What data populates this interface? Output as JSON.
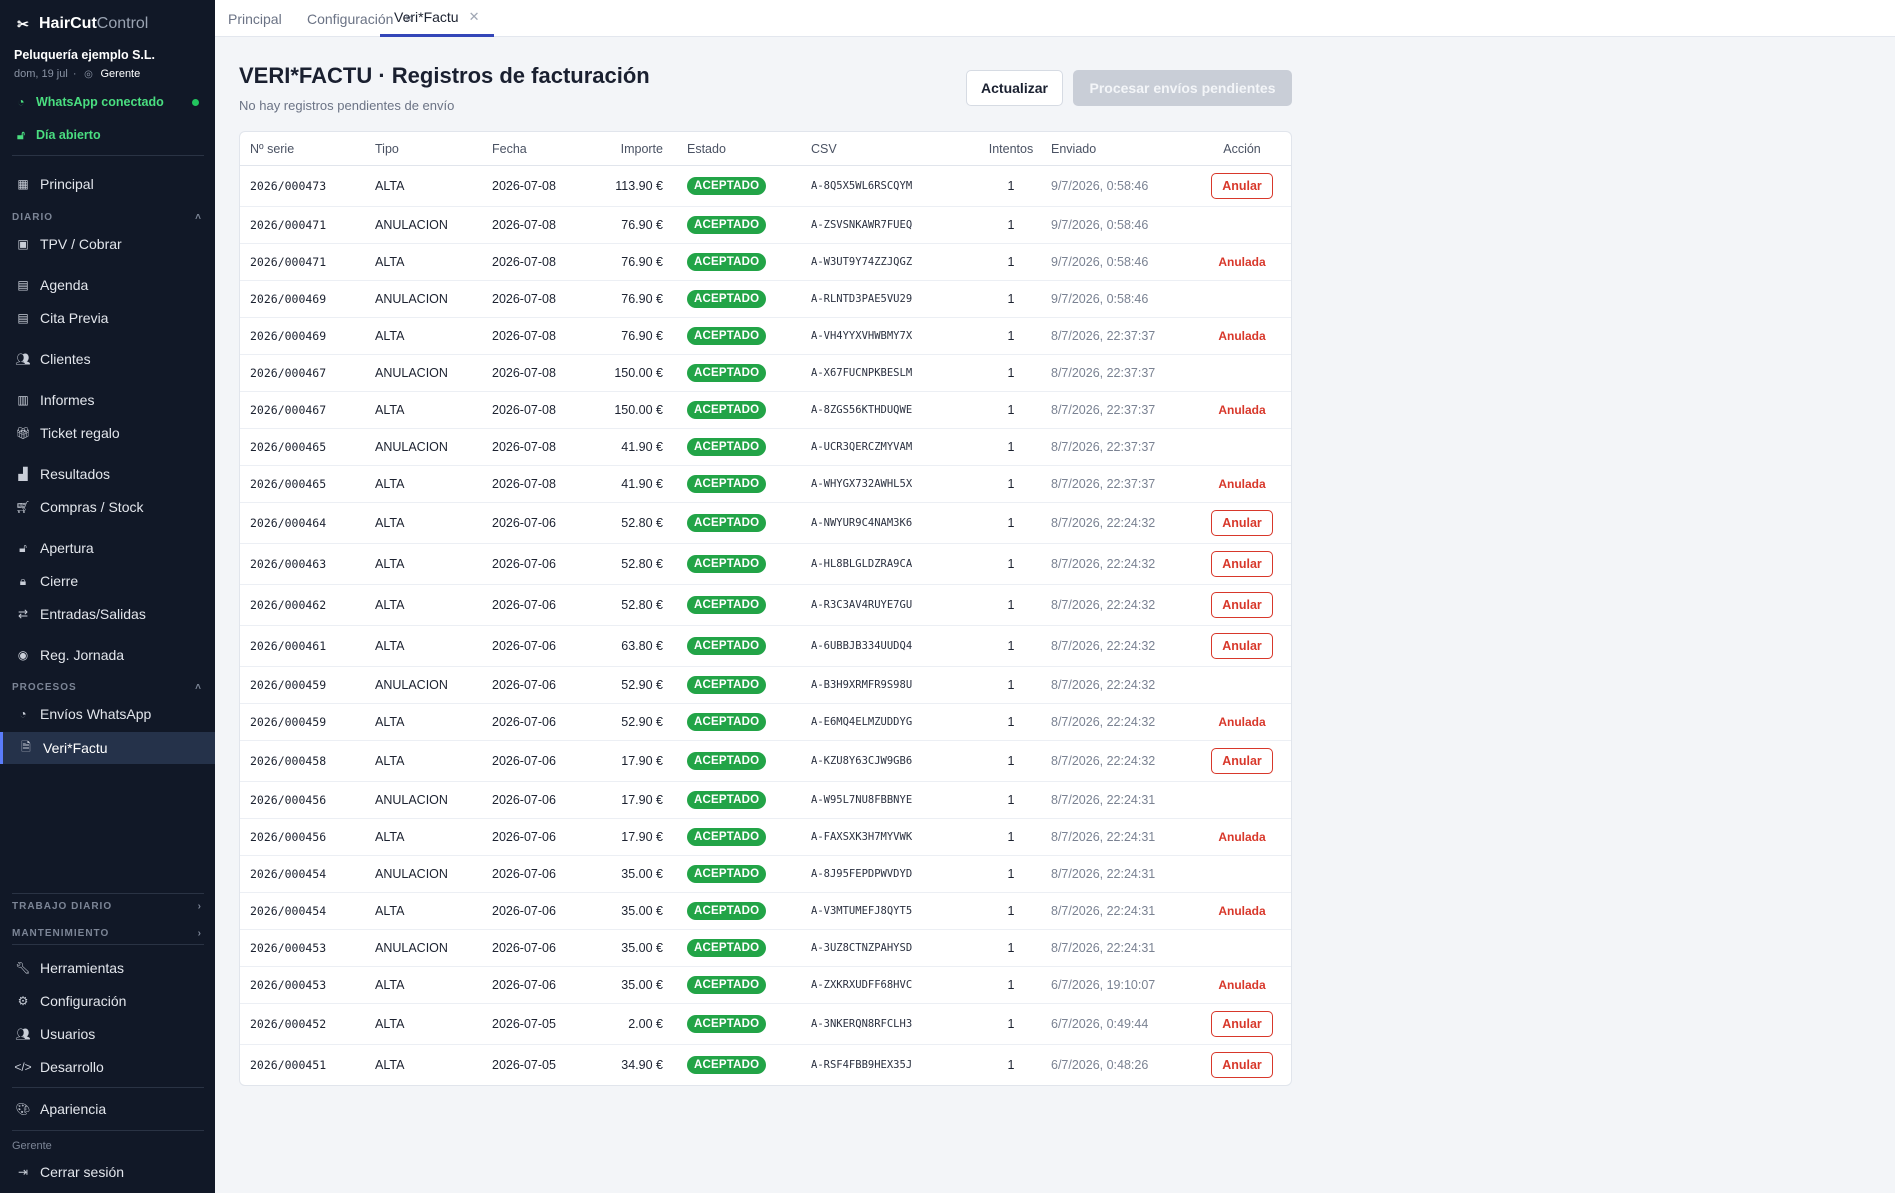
{
  "app": {
    "brand_a": "HairCut",
    "brand_b": "Control",
    "company": "Peluquería ejemplo S.L.",
    "date": "dom, 19 jul",
    "role": "Gerente"
  },
  "status": {
    "whatsapp": "WhatsApp conectado",
    "day": "Día abierto"
  },
  "sidebar": {
    "principal": "Principal",
    "sec_diario": "DIARIO",
    "items_diario": [
      "TPV / Cobrar",
      "Agenda",
      "Cita Previa",
      "Clientes",
      "Informes",
      "Ticket regalo",
      "Resultados",
      "Compras / Stock",
      "Apertura",
      "Cierre",
      "Entradas/Salidas",
      "Reg. Jornada"
    ],
    "sec_procesos": "PROCESOS",
    "items_procesos": [
      "Envíos WhatsApp",
      "Veri*Factu"
    ],
    "sec_trabajo": "TRABAJO DIARIO",
    "sec_mant": "MANTENIMIENTO",
    "items_mant": [
      "Herramientas",
      "Configuración",
      "Usuarios",
      "Desarrollo"
    ],
    "apariencia": "Apariencia",
    "footer_role": "Gerente",
    "logout": "Cerrar sesión"
  },
  "tabs": [
    {
      "label": "Principal"
    },
    {
      "label": "Configuración"
    },
    {
      "label": "Veri*Factu"
    }
  ],
  "page": {
    "title": "VERI*FACTU · Registros de facturación",
    "subtitle": "No hay registros pendientes de envío",
    "btn_refresh": "Actualizar",
    "btn_process": "Procesar envíos pendientes"
  },
  "table": {
    "headers": [
      "Nº serie",
      "Tipo",
      "Fecha",
      "Importe",
      "Estado",
      "CSV",
      "Intentos",
      "Enviado",
      "Acción"
    ],
    "rows": [
      {
        "serie": "2026/000473",
        "tipo": "ALTA",
        "fecha": "2026-07-08",
        "importe": "113.90 €",
        "estado": "ACEPTADO",
        "csv": "A-8Q5X5WL6RSCQYM",
        "intentos": "1",
        "enviado": "9/7/2026, 0:58:46",
        "accion": "Anular"
      },
      {
        "serie": "2026/000471",
        "tipo": "ANULACION",
        "fecha": "2026-07-08",
        "importe": "76.90 €",
        "estado": "ACEPTADO",
        "csv": "A-ZSVSNKAWR7FUEQ",
        "intentos": "1",
        "enviado": "9/7/2026, 0:58:46",
        "accion": ""
      },
      {
        "serie": "2026/000471",
        "tipo": "ALTA",
        "fecha": "2026-07-08",
        "importe": "76.90 €",
        "estado": "ACEPTADO",
        "csv": "A-W3UT9Y74ZZJQGZ",
        "intentos": "1",
        "enviado": "9/7/2026, 0:58:46",
        "accion": "Anulada"
      },
      {
        "serie": "2026/000469",
        "tipo": "ANULACION",
        "fecha": "2026-07-08",
        "importe": "76.90 €",
        "estado": "ACEPTADO",
        "csv": "A-RLNTD3PAE5VU29",
        "intentos": "1",
        "enviado": "9/7/2026, 0:58:46",
        "accion": ""
      },
      {
        "serie": "2026/000469",
        "tipo": "ALTA",
        "fecha": "2026-07-08",
        "importe": "76.90 €",
        "estado": "ACEPTADO",
        "csv": "A-VH4YYXVHWBMY7X",
        "intentos": "1",
        "enviado": "8/7/2026, 22:37:37",
        "accion": "Anulada"
      },
      {
        "serie": "2026/000467",
        "tipo": "ANULACION",
        "fecha": "2026-07-08",
        "importe": "150.00 €",
        "estado": "ACEPTADO",
        "csv": "A-X67FUCNPKBESLM",
        "intentos": "1",
        "enviado": "8/7/2026, 22:37:37",
        "accion": ""
      },
      {
        "serie": "2026/000467",
        "tipo": "ALTA",
        "fecha": "2026-07-08",
        "importe": "150.00 €",
        "estado": "ACEPTADO",
        "csv": "A-8ZGS56KTHDUQWE",
        "intentos": "1",
        "enviado": "8/7/2026, 22:37:37",
        "accion": "Anulada"
      },
      {
        "serie": "2026/000465",
        "tipo": "ANULACION",
        "fecha": "2026-07-08",
        "importe": "41.90 €",
        "estado": "ACEPTADO",
        "csv": "A-UCR3QERCZMYVAM",
        "intentos": "1",
        "enviado": "8/7/2026, 22:37:37",
        "accion": ""
      },
      {
        "serie": "2026/000465",
        "tipo": "ALTA",
        "fecha": "2026-07-08",
        "importe": "41.90 €",
        "estado": "ACEPTADO",
        "csv": "A-WHYGX732AWHL5X",
        "intentos": "1",
        "enviado": "8/7/2026, 22:37:37",
        "accion": "Anulada"
      },
      {
        "serie": "2026/000464",
        "tipo": "ALTA",
        "fecha": "2026-07-06",
        "importe": "52.80 €",
        "estado": "ACEPTADO",
        "csv": "A-NWYUR9C4NAM3K6",
        "intentos": "1",
        "enviado": "8/7/2026, 22:24:32",
        "accion": "Anular"
      },
      {
        "serie": "2026/000463",
        "tipo": "ALTA",
        "fecha": "2026-07-06",
        "importe": "52.80 €",
        "estado": "ACEPTADO",
        "csv": "A-HL8BLGLDZRA9CA",
        "intentos": "1",
        "enviado": "8/7/2026, 22:24:32",
        "accion": "Anular"
      },
      {
        "serie": "2026/000462",
        "tipo": "ALTA",
        "fecha": "2026-07-06",
        "importe": "52.80 €",
        "estado": "ACEPTADO",
        "csv": "A-R3C3AV4RUYE7GU",
        "intentos": "1",
        "enviado": "8/7/2026, 22:24:32",
        "accion": "Anular"
      },
      {
        "serie": "2026/000461",
        "tipo": "ALTA",
        "fecha": "2026-07-06",
        "importe": "63.80 €",
        "estado": "ACEPTADO",
        "csv": "A-6UBBJB334UUDQ4",
        "intentos": "1",
        "enviado": "8/7/2026, 22:24:32",
        "accion": "Anular"
      },
      {
        "serie": "2026/000459",
        "tipo": "ANULACION",
        "fecha": "2026-07-06",
        "importe": "52.90 €",
        "estado": "ACEPTADO",
        "csv": "A-B3H9XRMFR9S98U",
        "intentos": "1",
        "enviado": "8/7/2026, 22:24:32",
        "accion": ""
      },
      {
        "serie": "2026/000459",
        "tipo": "ALTA",
        "fecha": "2026-07-06",
        "importe": "52.90 €",
        "estado": "ACEPTADO",
        "csv": "A-E6MQ4ELMZUDDYG",
        "intentos": "1",
        "enviado": "8/7/2026, 22:24:32",
        "accion": "Anulada"
      },
      {
        "serie": "2026/000458",
        "tipo": "ALTA",
        "fecha": "2026-07-06",
        "importe": "17.90 €",
        "estado": "ACEPTADO",
        "csv": "A-KZU8Y63CJW9GB6",
        "intentos": "1",
        "enviado": "8/7/2026, 22:24:32",
        "accion": "Anular"
      },
      {
        "serie": "2026/000456",
        "tipo": "ANULACION",
        "fecha": "2026-07-06",
        "importe": "17.90 €",
        "estado": "ACEPTADO",
        "csv": "A-W95L7NU8FBBNYE",
        "intentos": "1",
        "enviado": "8/7/2026, 22:24:31",
        "accion": ""
      },
      {
        "serie": "2026/000456",
        "tipo": "ALTA",
        "fecha": "2026-07-06",
        "importe": "17.90 €",
        "estado": "ACEPTADO",
        "csv": "A-FAXSXK3H7MYVWK",
        "intentos": "1",
        "enviado": "8/7/2026, 22:24:31",
        "accion": "Anulada"
      },
      {
        "serie": "2026/000454",
        "tipo": "ANULACION",
        "fecha": "2026-07-06",
        "importe": "35.00 €",
        "estado": "ACEPTADO",
        "csv": "A-8J95FEPDPWVDYD",
        "intentos": "1",
        "enviado": "8/7/2026, 22:24:31",
        "accion": ""
      },
      {
        "serie": "2026/000454",
        "tipo": "ALTA",
        "fecha": "2026-07-06",
        "importe": "35.00 €",
        "estado": "ACEPTADO",
        "csv": "A-V3MTUMEFJ8QYT5",
        "intentos": "1",
        "enviado": "8/7/2026, 22:24:31",
        "accion": "Anulada"
      },
      {
        "serie": "2026/000453",
        "tipo": "ANULACION",
        "fecha": "2026-07-06",
        "importe": "35.00 €",
        "estado": "ACEPTADO",
        "csv": "A-3UZ8CTNZPAHYSD",
        "intentos": "1",
        "enviado": "8/7/2026, 22:24:31",
        "accion": ""
      },
      {
        "serie": "2026/000453",
        "tipo": "ALTA",
        "fecha": "2026-07-06",
        "importe": "35.00 €",
        "estado": "ACEPTADO",
        "csv": "A-ZXKRXUDFF68HVC",
        "intentos": "1",
        "enviado": "6/7/2026, 19:10:07",
        "accion": "Anulada"
      },
      {
        "serie": "2026/000452",
        "tipo": "ALTA",
        "fecha": "2026-07-05",
        "importe": "2.00 €",
        "estado": "ACEPTADO",
        "csv": "A-3NKERQN8RFCLH3",
        "intentos": "1",
        "enviado": "6/7/2026, 0:49:44",
        "accion": "Anular"
      },
      {
        "serie": "2026/000451",
        "tipo": "ALTA",
        "fecha": "2026-07-05",
        "importe": "34.90 €",
        "estado": "ACEPTADO",
        "csv": "A-RSF4FBB9HEX35J",
        "intentos": "1",
        "enviado": "6/7/2026, 0:48:26",
        "accion": "Anular"
      }
    ]
  },
  "colors": {
    "accent": "#3446b8",
    "success": "#22a447",
    "danger": "#d8382b",
    "sidebar_bg": "#111827"
  }
}
